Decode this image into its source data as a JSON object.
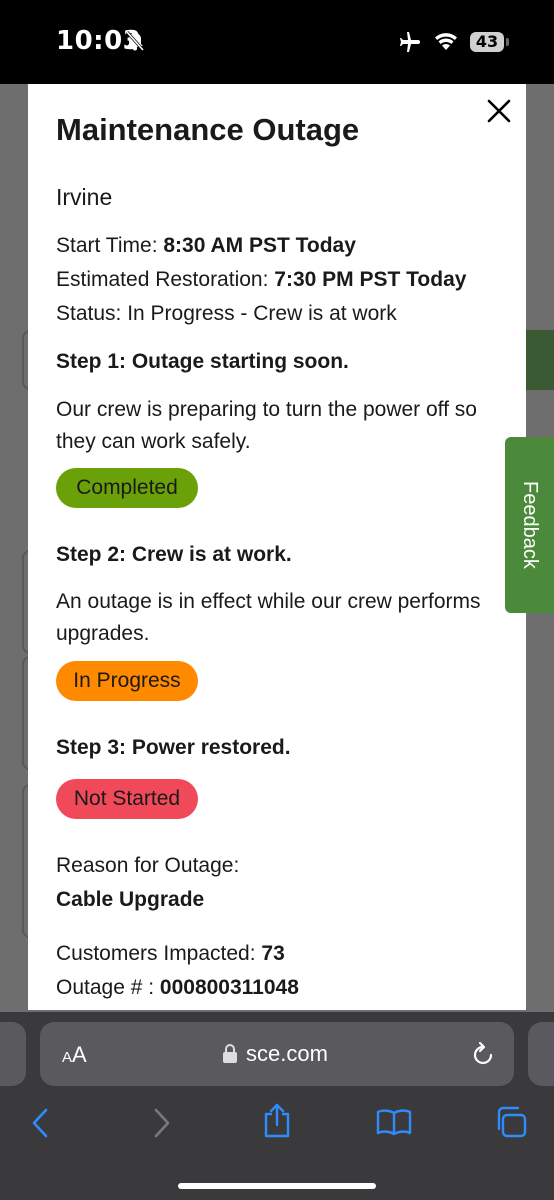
{
  "status_bar": {
    "time": "10:03",
    "battery": "43"
  },
  "modal": {
    "title": "Maintenance Outage",
    "city": "Irvine",
    "start_time_label": "Start Time: ",
    "start_time_value": "8:30 AM PST Today",
    "restoration_label": "Estimated Restoration: ",
    "restoration_value": "7:30 PM PST Today",
    "status_line": "Status: In Progress - Crew is at work",
    "steps": [
      {
        "title": "Step 1: Outage starting soon.",
        "description": "Our crew is preparing to turn the power off so they can work safely.",
        "badge": "Completed",
        "badge_color": "#6aa108"
      },
      {
        "title": "Step 2: Crew is at work.",
        "description": "An outage is in effect while our crew performs upgrades.",
        "badge": "In Progress",
        "badge_color": "#ff8a00"
      },
      {
        "title": "Step 3: Power restored.",
        "badge": "Not Started",
        "badge_color": "#f04a5a"
      }
    ],
    "reason_label": "Reason for Outage:",
    "reason_value": "Cable Upgrade",
    "customers_label": "Customers Impacted: ",
    "customers_value": "73",
    "outage_label": "Outage # : ",
    "outage_value": "000800311048"
  },
  "feedback_tab": "Feedback",
  "browser": {
    "aa_label_small": "A",
    "aa_label_large": "A",
    "url": "sce.com"
  },
  "icons": [
    "bell-slash-icon",
    "airplane-icon",
    "wifi-icon",
    "close-icon",
    "lock-icon",
    "reload-icon",
    "back-icon",
    "forward-icon",
    "share-icon",
    "bookmarks-icon",
    "tabs-icon"
  ]
}
